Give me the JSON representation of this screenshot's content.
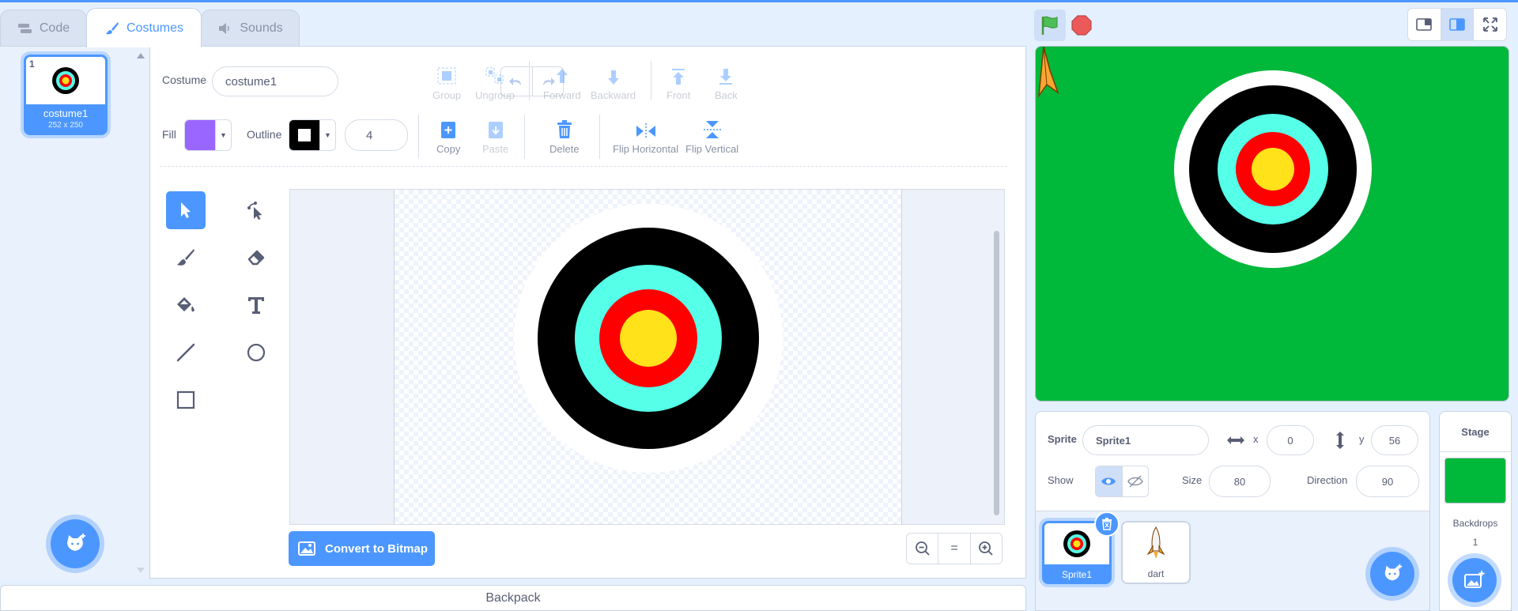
{
  "tabs": [
    {
      "label": "Code",
      "icon": "code-blocks-icon"
    },
    {
      "label": "Costumes",
      "icon": "paintbrush-icon"
    },
    {
      "label": "Sounds",
      "icon": "speaker-icon"
    }
  ],
  "costume_list": {
    "items": [
      {
        "number": "1",
        "name": "costume1",
        "size": "252 x 250"
      }
    ]
  },
  "paint": {
    "costume_label": "Costume",
    "costume_name": "costume1",
    "toolbar": {
      "group": "Group",
      "ungroup": "Ungroup",
      "forward": "Forward",
      "backward": "Backward",
      "front": "Front",
      "back": "Back",
      "copy": "Copy",
      "paste": "Paste",
      "delete": "Delete",
      "flip_h": "Flip Horizontal",
      "flip_v": "Flip Vertical"
    },
    "fill_label": "Fill",
    "fill_color": "#9966ff",
    "outline_label": "Outline",
    "outline_color": "#000000",
    "outline_width": "4",
    "convert_label": "Convert to Bitmap",
    "zoom_reset": "="
  },
  "target_colors": {
    "outer": "#ffffff",
    "ring1": "#000000",
    "ring2": "#55ffe8",
    "ring3": "#ff0000",
    "center": "#ffe21a"
  },
  "backpack_label": "Backpack",
  "stage_bg": "#00b83a",
  "sprite_info": {
    "sprite_label": "Sprite",
    "sprite_name": "Sprite1",
    "x_label": "x",
    "x_value": "0",
    "y_label": "y",
    "y_value": "56",
    "show_label": "Show",
    "size_label": "Size",
    "size_value": "80",
    "direction_label": "Direction",
    "direction_value": "90"
  },
  "sprites": [
    {
      "name": "Sprite1"
    },
    {
      "name": "dart"
    }
  ],
  "stage_pane": {
    "title": "Stage",
    "backdrops_label": "Backdrops",
    "backdrops_count": "1"
  }
}
